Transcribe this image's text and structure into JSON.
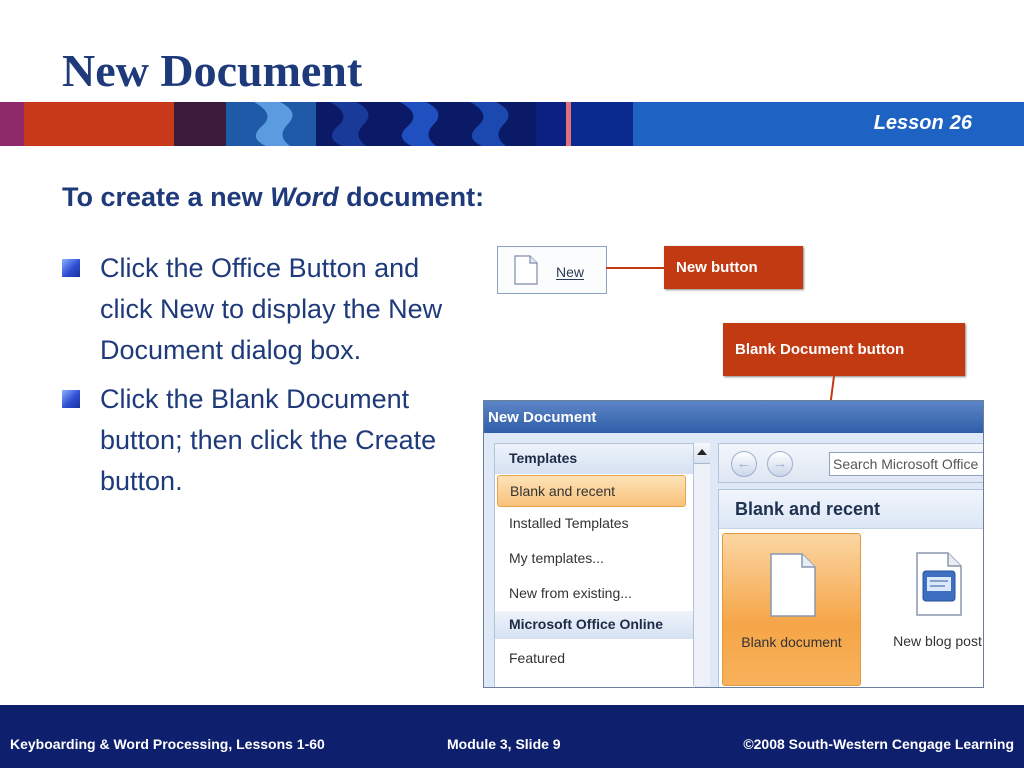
{
  "slide": {
    "title": "New Document",
    "lesson_label": "Lesson",
    "lesson_number": "26",
    "subtitle_pre": "To create a new ",
    "subtitle_em": "Word",
    "subtitle_post": " document:",
    "bullets": [
      "Click the Office Button and click New to display the New Document dialog box.",
      "Click the Blank Document button; then click the Create button."
    ]
  },
  "office_menu": {
    "new_label": "New",
    "new_icon": "blank-document-icon"
  },
  "callouts": {
    "new_button": "New button",
    "blank_document_button": "Blank Document button"
  },
  "dialog": {
    "title": "New Document",
    "left_pane": {
      "templates_header": "Templates",
      "items": [
        "Blank and recent",
        "Installed Templates",
        "My templates...",
        "New from existing..."
      ],
      "online_header": "Microsoft Office Online",
      "online_items": [
        "Featured"
      ]
    },
    "nav": {
      "back_icon": "back-arrow-icon",
      "forward_icon": "forward-arrow-icon"
    },
    "search_placeholder": "Search Microsoft Office Online",
    "section_title": "Blank and recent",
    "tiles": [
      {
        "label": "Blank document",
        "icon": "blank-document-icon"
      },
      {
        "label": "New blog post",
        "icon": "blog-post-icon"
      }
    ]
  },
  "footer": {
    "left": "Keyboarding & Word Processing, Lessons 1-60",
    "center": "Module 3, Slide 9",
    "right": "©2008 South-Western Cengage Learning"
  },
  "colors": {
    "title": "#1f3a7a",
    "callout": "#c23a12",
    "footer": "#0e1f6e",
    "band_blue": "#1e63c4"
  }
}
